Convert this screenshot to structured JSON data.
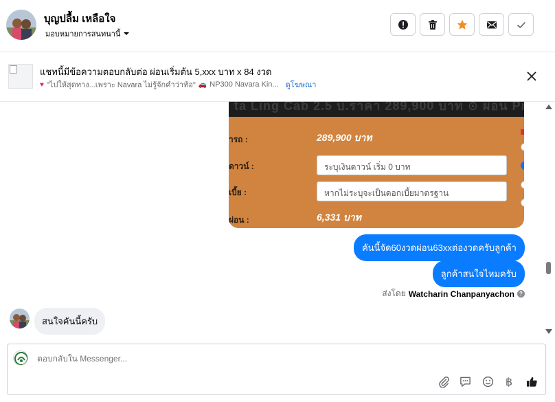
{
  "header": {
    "contact_name": "บุญปลื้ม เหลือใจ",
    "assign_label": "มอบหมายการสนทนานี้",
    "actions": [
      {
        "name": "mark-spam-button",
        "icon": "alert-circle-icon"
      },
      {
        "name": "delete-button",
        "icon": "trash-icon"
      },
      {
        "name": "star-button",
        "icon": "star-icon",
        "color": "#f28c22"
      },
      {
        "name": "mark-unread-button",
        "icon": "envelope-icon"
      },
      {
        "name": "mark-done-button",
        "icon": "checkmark-icon"
      }
    ]
  },
  "ad_banner": {
    "title": "แชทนี้มีข้อความตอบกลับต่อ ผ่อนเริ่มต้น 5,xxx บาท x 84 งวด",
    "subtitle_left": "\"ไปให้สุดทาง...เพราะ Navara ไม่รู้จักคำว่าท้อ\"",
    "subtitle_right": "NP300 Navara Kin...",
    "link": "ดูโฆษณา"
  },
  "image_message": {
    "rows": [
      {
        "label": "ารถ :",
        "value": "289,900 บาท"
      },
      {
        "label": "ดาวน์ :",
        "input_placeholder": "ระบุเงินดาวน์ เริ่ม 0 บาท"
      },
      {
        "label": "เบี้ย :",
        "input_placeholder": "หากไม่ระบุจะเป็นดอกเบี้ยมาตรฐาน"
      },
      {
        "label": "ผ่อน :",
        "value": "6,331 บาท"
      }
    ]
  },
  "messages": {
    "outgoing": [
      "คันนี้จัด60งวดผ่อน63xxต่องวดครับลูกค้า",
      "ลูกค้าสนใจไหมครับ"
    ],
    "sent_by_label": "ส่งโดย",
    "sent_by_name": "Watcharin Chanpanyachon",
    "incoming": "สนใจคันนี้ครับ"
  },
  "composer": {
    "placeholder": "ตอบกลับใน Messenger...",
    "baht_symbol": "฿"
  },
  "colors": {
    "accent": "#0a7cff",
    "star": "#f28c22",
    "ad_image_bg": "#d0843f"
  }
}
